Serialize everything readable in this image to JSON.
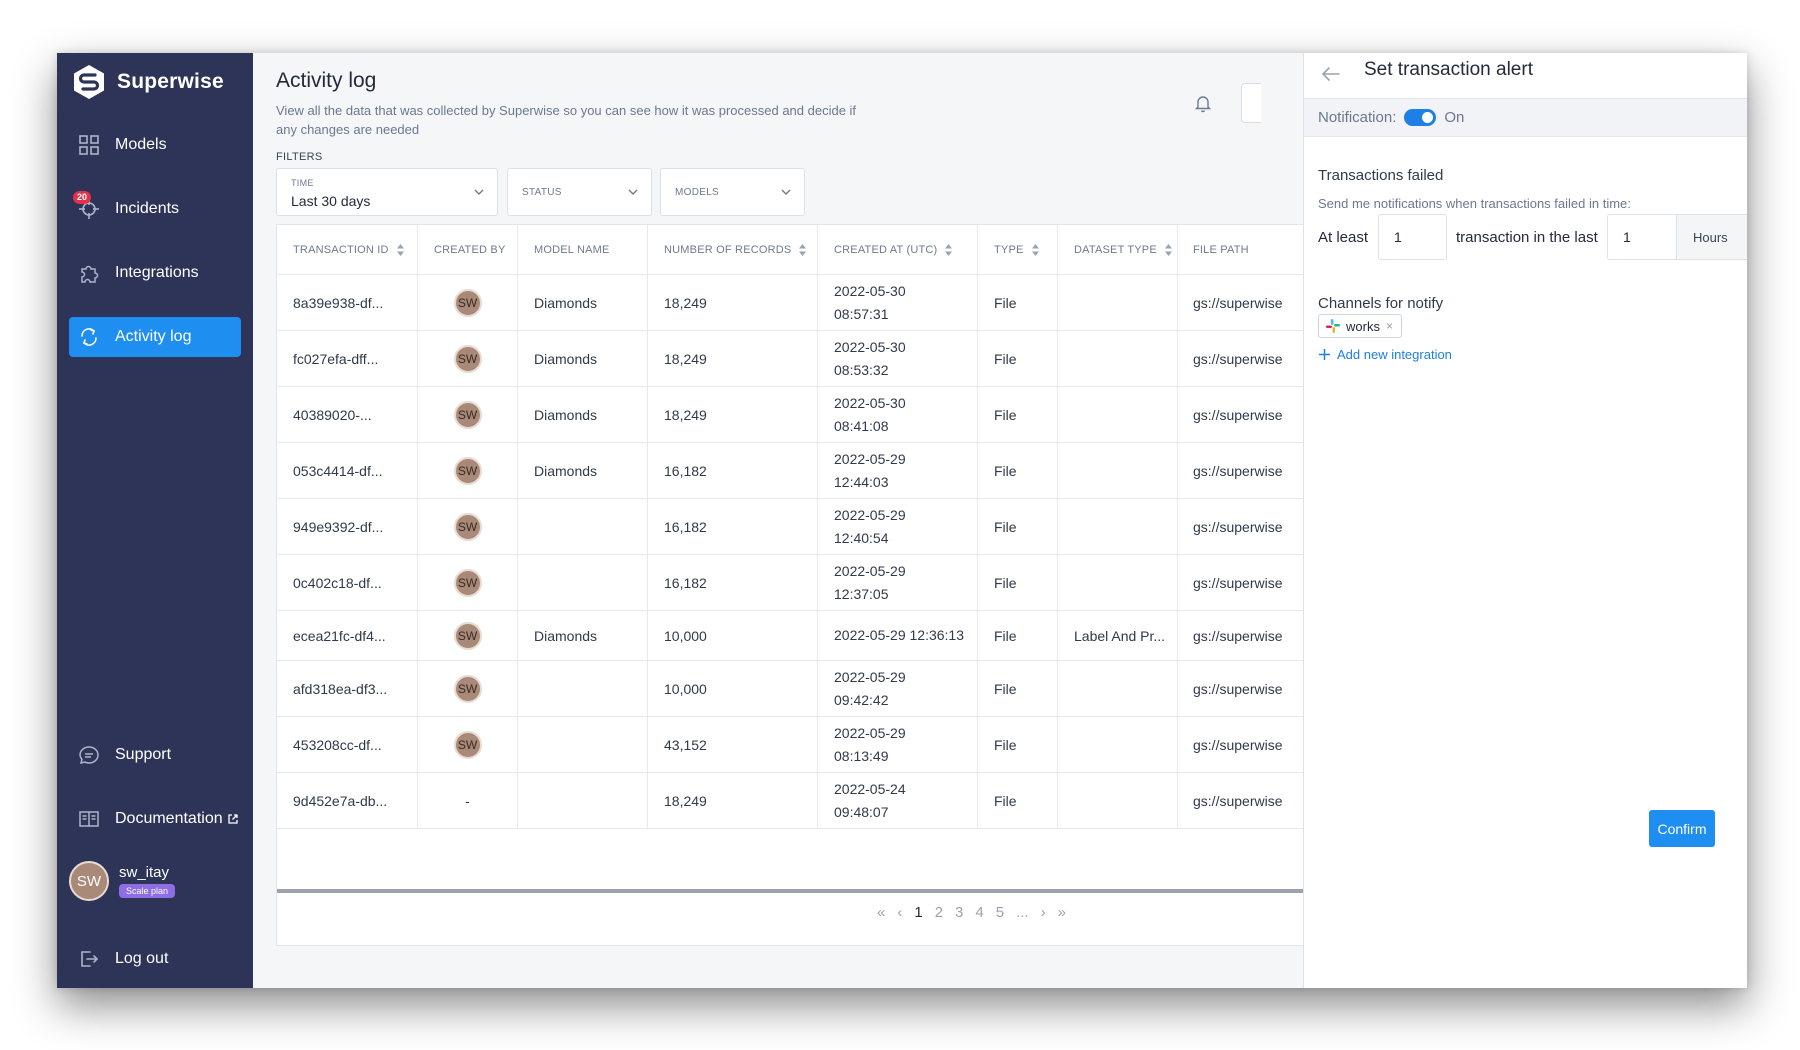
{
  "app": {
    "name": "Superwise"
  },
  "sidebar": {
    "items": [
      {
        "label": "Models",
        "icon": "grid-icon"
      },
      {
        "label": "Incidents",
        "icon": "crosshair-icon",
        "badge": "20"
      },
      {
        "label": "Integrations",
        "icon": "puzzle-icon"
      },
      {
        "label": "Activity log",
        "icon": "sync-icon",
        "active": true
      }
    ],
    "bottom_items": [
      {
        "label": "Support",
        "icon": "chat-icon"
      },
      {
        "label": "Documentation",
        "icon": "book-icon"
      }
    ],
    "user": {
      "initials": "SW",
      "name": "sw_itay",
      "plan": "Scale plan"
    },
    "logout_label": "Log out"
  },
  "main": {
    "title": "Activity log",
    "subtitle": "View all the data that was collected by Superwise so you can see how it was processed and decide if any changes are needed",
    "filters_label": "FILTERS",
    "filters": {
      "time": {
        "caption": "TIME",
        "value": "Last 30 days"
      },
      "status": {
        "caption": "STATUS"
      },
      "models": {
        "caption": "MODELS"
      }
    },
    "table": {
      "columns": [
        "TRANSACTION ID",
        "CREATED BY",
        "MODEL NAME",
        "NUMBER OF RECORDS",
        "CREATED AT (UTC)",
        "TYPE",
        "DATASET TYPE",
        "FILE PATH"
      ],
      "rows": [
        {
          "id": "8a39e938-df...",
          "created_by": "SW",
          "model": "Diamonds",
          "records": "18,249",
          "date": "2022-05-30",
          "time": "08:57:31",
          "type": "File",
          "dataset": "",
          "path": "gs://superwise"
        },
        {
          "id": "fc027efa-dff...",
          "created_by": "SW",
          "model": "Diamonds",
          "records": "18,249",
          "date": "2022-05-30",
          "time": "08:53:32",
          "type": "File",
          "dataset": "",
          "path": "gs://superwise"
        },
        {
          "id": "40389020-...",
          "created_by": "SW",
          "model": "Diamonds",
          "records": "18,249",
          "date": "2022-05-30",
          "time": "08:41:08",
          "type": "File",
          "dataset": "",
          "path": "gs://superwise"
        },
        {
          "id": "053c4414-df...",
          "created_by": "SW",
          "model": "Diamonds",
          "records": "16,182",
          "date": "2022-05-29",
          "time": "12:44:03",
          "type": "File",
          "dataset": "",
          "path": "gs://superwise"
        },
        {
          "id": "949e9392-df...",
          "created_by": "SW",
          "model": "",
          "records": "16,182",
          "date": "2022-05-29",
          "time": "12:40:54",
          "type": "File",
          "dataset": "",
          "path": "gs://superwise"
        },
        {
          "id": "0c402c18-df...",
          "created_by": "SW",
          "model": "",
          "records": "16,182",
          "date": "2022-05-29",
          "time": "12:37:05",
          "type": "File",
          "dataset": "",
          "path": "gs://superwise"
        },
        {
          "id": "ecea21fc-df4...",
          "created_by": "SW",
          "model": "Diamonds",
          "records": "10,000",
          "date": "2022-05-29 12:36:13",
          "time": "",
          "type": "File",
          "dataset": "Label And Pr...",
          "path": "gs://superwise"
        },
        {
          "id": "afd318ea-df3...",
          "created_by": "SW",
          "model": "",
          "records": "10,000",
          "date": "2022-05-29",
          "time": "09:42:42",
          "type": "File",
          "dataset": "",
          "path": "gs://superwise"
        },
        {
          "id": "453208cc-df...",
          "created_by": "SW",
          "model": "",
          "records": "43,152",
          "date": "2022-05-29",
          "time": "08:13:49",
          "type": "File",
          "dataset": "",
          "path": "gs://superwise"
        },
        {
          "id": "9d452e7a-db...",
          "created_by": "-",
          "model": "",
          "records": "18,249",
          "date": "2022-05-24",
          "time": "09:48:07",
          "type": "File",
          "dataset": "",
          "path": "gs://superwise"
        }
      ]
    },
    "pagination": {
      "pages": [
        "1",
        "2",
        "3",
        "4",
        "5"
      ],
      "ellipsis": "...",
      "current": "1"
    }
  },
  "panel": {
    "title": "Set transaction alert",
    "notification_label": "Notification:",
    "notification_state": "On",
    "section_title": "Transactions failed",
    "section_sub": "Send me notifications when transactions failed in time:",
    "at_least_label": "At least",
    "count_value": "1",
    "middle_label": "transaction in the last",
    "period_value": "1",
    "unit_value": "Hours",
    "channels_title": "Channels for notify",
    "channel_chip": "works",
    "add_integration": "Add new integration",
    "confirm_label": "Confirm"
  },
  "colors": {
    "sidebar_bg": "#2e3458",
    "accent": "#1e8ef0",
    "badge": "#e0334b",
    "avatar": "#a98978"
  }
}
